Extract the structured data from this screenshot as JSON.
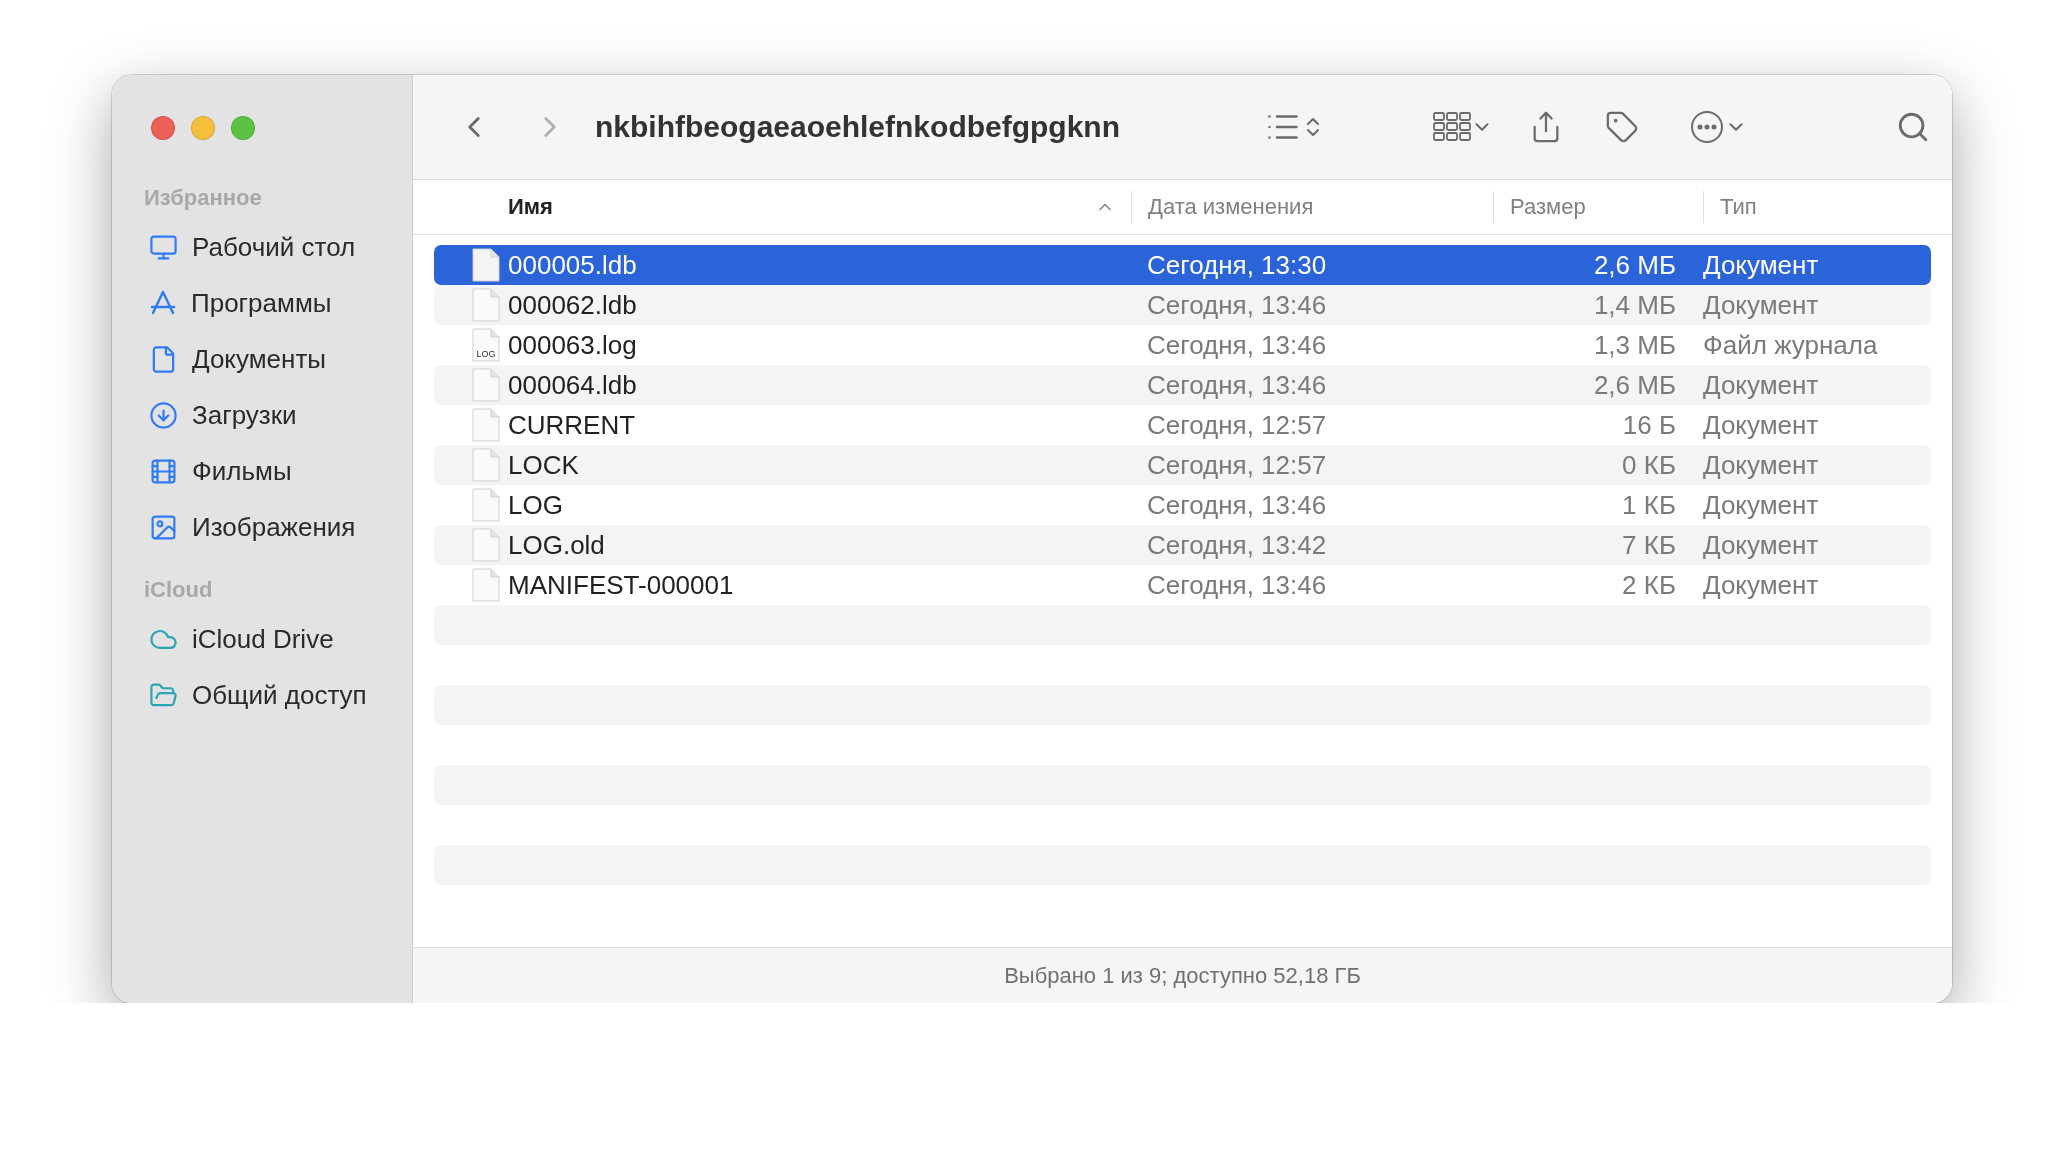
{
  "window": {
    "title": "nkbihfbeogaeaoehlefnkodbefgpgknn"
  },
  "toolbar": {
    "back_enabled": true,
    "forward_enabled": false
  },
  "sidebar": {
    "sections": [
      {
        "title": "Избранное",
        "items": [
          "Рабочий стол",
          "Программы",
          "Документы",
          "Загрузки",
          "Фильмы",
          "Изображения"
        ]
      },
      {
        "title": "iCloud",
        "items": [
          "iCloud Drive",
          "Общий доступ"
        ]
      }
    ]
  },
  "table": {
    "columns": [
      {
        "label": "Имя",
        "sorted": true
      },
      {
        "label": "Дата изменения",
        "sorted": false
      },
      {
        "label": "Размер",
        "sorted": false
      },
      {
        "label": "Тип",
        "sorted": false
      }
    ],
    "rows": [
      {
        "name": "000005.ldb",
        "date": "Сегодня, 13:30",
        "size": "2,6 МБ",
        "type": "Документ",
        "selected": true
      },
      {
        "name": "000062.ldb",
        "date": "Сегодня, 13:46",
        "size": "1,4 МБ",
        "type": "Документ",
        "selected": false
      },
      {
        "name": "000063.log",
        "date": "Сегодня, 13:46",
        "size": "1,3 МБ",
        "type": "Файл журнала",
        "selected": false,
        "icon_label": "LOG"
      },
      {
        "name": "000064.ldb",
        "date": "Сегодня, 13:46",
        "size": "2,6 МБ",
        "type": "Документ",
        "selected": false
      },
      {
        "name": "CURRENT",
        "date": "Сегодня, 12:57",
        "size": "16 Б",
        "type": "Документ",
        "selected": false
      },
      {
        "name": "LOCK",
        "date": "Сегодня, 12:57",
        "size": "0 КБ",
        "type": "Документ",
        "selected": false
      },
      {
        "name": "LOG",
        "date": "Сегодня, 13:46",
        "size": "1 КБ",
        "type": "Документ",
        "selected": false
      },
      {
        "name": "LOG.old",
        "date": "Сегодня, 13:42",
        "size": "7 КБ",
        "type": "Документ",
        "selected": false
      },
      {
        "name": "MANIFEST-000001",
        "date": "Сегодня, 13:46",
        "size": "2 КБ",
        "type": "Документ",
        "selected": false
      }
    ]
  },
  "status_bar": "Выбрано 1 из 9; доступно 52,18 ГБ"
}
